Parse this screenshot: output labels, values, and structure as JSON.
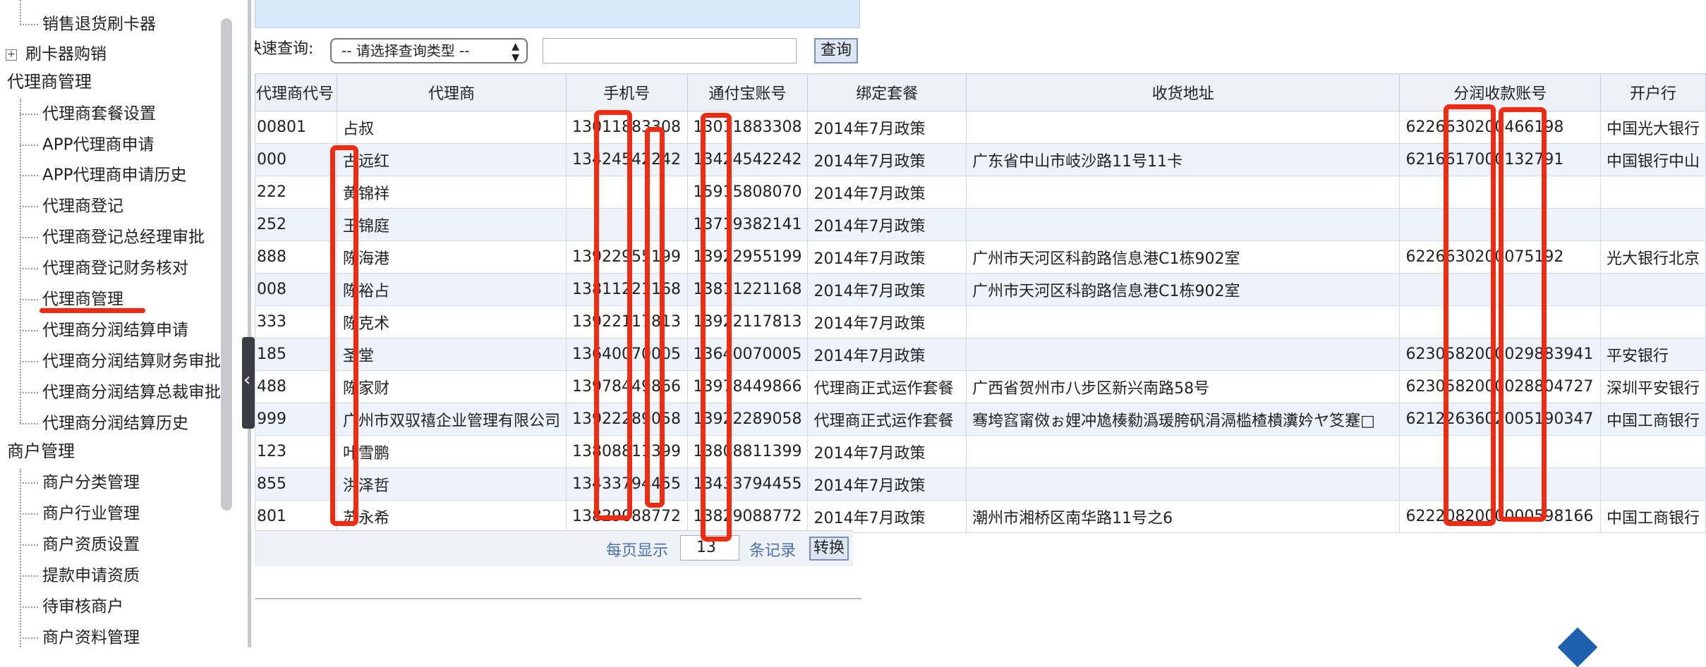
{
  "sidebar": {
    "items": [
      {
        "label": "销售退货刷卡器",
        "type": "child"
      },
      {
        "label": "刷卡器购销",
        "type": "collapsed"
      },
      {
        "label": "代理商管理",
        "type": "section"
      },
      {
        "label": "代理商套餐设置",
        "type": "child"
      },
      {
        "label": "APP代理商申请",
        "type": "child"
      },
      {
        "label": "APP代理商申请历史",
        "type": "child"
      },
      {
        "label": "代理商登记",
        "type": "child"
      },
      {
        "label": "代理商登记总经理审批",
        "type": "child"
      },
      {
        "label": "代理商登记财务核对",
        "type": "child"
      },
      {
        "label": "代理商管理",
        "type": "child"
      },
      {
        "label": "代理商分润结算申请",
        "type": "child"
      },
      {
        "label": "代理商分润结算财务审批",
        "type": "child"
      },
      {
        "label": "代理商分润结算总裁审批",
        "type": "child"
      },
      {
        "label": "代理商分润结算历史",
        "type": "child"
      },
      {
        "label": "商户管理",
        "type": "section"
      },
      {
        "label": "商户分类管理",
        "type": "child"
      },
      {
        "label": "商户行业管理",
        "type": "child"
      },
      {
        "label": "商户资质设置",
        "type": "child"
      },
      {
        "label": "提款申请资质",
        "type": "child"
      },
      {
        "label": "待审核商户",
        "type": "child"
      },
      {
        "label": "商户资料管理",
        "type": "child"
      }
    ],
    "expand_symbol": "+"
  },
  "splitter": {
    "arrow": "‹"
  },
  "query": {
    "label": "快速查询:",
    "select_value": "-- 请选择查询类型 --",
    "select_arrows": "▲▼",
    "input_value": "",
    "button_label": "查询"
  },
  "table": {
    "columns": [
      "代理商代号",
      "代理商",
      "手机号",
      "通付宝账号",
      "绑定套餐",
      "收货地址",
      "分润收款账号",
      "开户行"
    ],
    "rows": [
      [
        "00801",
        "占叔",
        "13011883308",
        "13011883308",
        "2014年7月政策",
        "",
        "6226630200466198",
        "中国光大银行"
      ],
      [
        "000",
        "古远红",
        "13424542242",
        "13424542242",
        "2014年7月政策",
        "广东省中山市岐沙路11号11卡",
        "6216617000132791",
        "中国银行中山"
      ],
      [
        "222",
        "黄锦祥",
        "",
        "15915808070",
        "2014年7月政策",
        "",
        "",
        ""
      ],
      [
        "252",
        "王锦庭",
        "",
        "13719382141",
        "2014年7月政策",
        "",
        "",
        ""
      ],
      [
        "888",
        "陈海港",
        "13922955199",
        "13922955199",
        "2014年7月政策",
        "广州市天河区科韵路信息港C1栋902室",
        "6226630200075192",
        "光大银行北京"
      ],
      [
        "008",
        "陈裕占",
        "13811221168",
        "13811221168",
        "2014年7月政策",
        "广州市天河区科韵路信息港C1栋902室",
        "",
        ""
      ],
      [
        "333",
        "陈克术",
        "13922117813",
        "13922117813",
        "2014年7月政策",
        "",
        "",
        ""
      ],
      [
        "185",
        "圣堂",
        "13640070005",
        "13640070005",
        "2014年7月政策",
        "",
        "6230582000029883941",
        "平安银行"
      ],
      [
        "488",
        "陈家财",
        "13978449866",
        "13978449866",
        "代理商正式运作套餐",
        "广西省贺州市八步区新兴南路58号",
        "6230582000028804727",
        "深圳平安银行"
      ],
      [
        "999",
        "广州市双驭禧企业管理有限公司",
        "13922289058",
        "13922289058",
        "代理商正式运作套餐",
        "骞垮窞甯傚ぉ娌冲尯楱勬潙瑗胯矾涓滆槛楂樻瀵妗ヤ笅蹇□",
        "6212263602005190347",
        "中国工商银行"
      ],
      [
        "123",
        "叶雪鹏",
        "13808811399",
        "13808811399",
        "2014年7月政策",
        "",
        "",
        ""
      ],
      [
        "855",
        "洪泽哲",
        "13433794455",
        "13433794455",
        "2014年7月政策",
        "",
        "",
        ""
      ],
      [
        "801",
        "苏永希",
        "13829088772",
        "13829088772",
        "2014年7月政策",
        "潮州市湘桥区南华路11号之6",
        "6222082000000598166",
        "中国工商银行"
      ]
    ]
  },
  "pager": {
    "per_page_label": "每页显示",
    "page_size_value": "13",
    "records_label": "条记录",
    "convert_label": "转换"
  },
  "annotation_color": "#f02b12"
}
